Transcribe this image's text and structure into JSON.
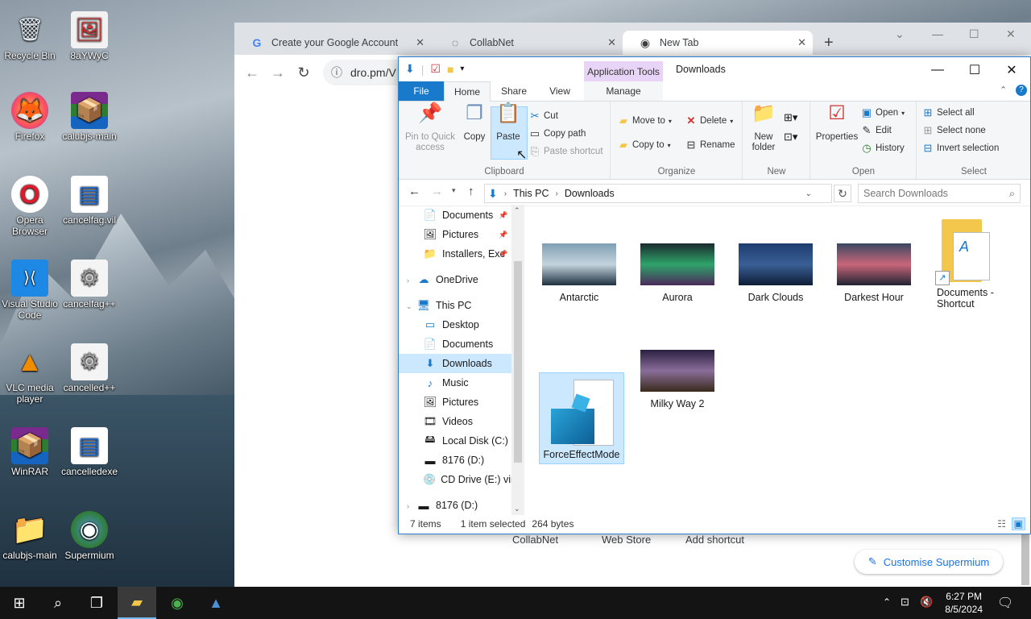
{
  "desktop": {
    "icons": [
      {
        "label": "Recycle Bin",
        "glyph": "🗑"
      },
      {
        "label": "8aYWyC",
        "glyph": "🖼"
      },
      {
        "label": "Firefox",
        "glyph": "🦊"
      },
      {
        "label": "calubjs-main",
        "glyph": "📦"
      },
      {
        "label": "Opera Browser",
        "glyph": "O"
      },
      {
        "label": "cancelfag.vil",
        "glyph": "▤"
      },
      {
        "label": "Visual Studio Code",
        "glyph": "⟩⟨"
      },
      {
        "label": "cancelfag++",
        "glyph": "⚙"
      },
      {
        "label": "VLC media player",
        "glyph": "▲"
      },
      {
        "label": "cancelled++",
        "glyph": "⚙"
      },
      {
        "label": "WinRAR",
        "glyph": "📦"
      },
      {
        "label": "cancelledexe",
        "glyph": "▤"
      },
      {
        "label": "calubjs-main",
        "glyph": "📁"
      },
      {
        "label": "Supermium",
        "glyph": "◉"
      }
    ]
  },
  "browser": {
    "tabs": [
      {
        "label": "Create your Google Account",
        "icon": "G"
      },
      {
        "label": "CollabNet",
        "icon": "◌"
      },
      {
        "label": "New Tab",
        "icon": "◉"
      }
    ],
    "new_tab": "+",
    "url": "dro.pm/V",
    "shortcuts": [
      "CollabNet",
      "Web Store",
      "Add shortcut"
    ],
    "customise_label": "Customise Supermium"
  },
  "explorer": {
    "app_tools": "Application Tools",
    "title": "Downloads",
    "ribbon_tabs": {
      "file": "File",
      "home": "Home",
      "share": "Share",
      "view": "View",
      "manage": "Manage"
    },
    "clipboard": {
      "pin": "Pin to Quick access",
      "copy": "Copy",
      "paste": "Paste",
      "cut": "Cut",
      "copy_path": "Copy path",
      "paste_shortcut": "Paste shortcut",
      "label": "Clipboard"
    },
    "organize": {
      "move_to": "Move to",
      "copy_to": "Copy to",
      "delete": "Delete",
      "rename": "Rename",
      "label": "Organize"
    },
    "new": {
      "new_folder": "New folder",
      "label": "New"
    },
    "open": {
      "properties": "Properties",
      "open": "Open",
      "edit": "Edit",
      "history": "History",
      "label": "Open"
    },
    "select": {
      "select_all": "Select all",
      "select_none": "Select none",
      "invert": "Invert selection",
      "label": "Select"
    },
    "path": {
      "root": "This PC",
      "current": "Downloads"
    },
    "search_placeholder": "Search Downloads",
    "nav": [
      {
        "label": "Documents",
        "icon": "📄",
        "pinned": "📌"
      },
      {
        "label": "Pictures",
        "icon": "🖼",
        "pinned": "📌"
      },
      {
        "label": "Installers, Exe",
        "icon": "📁",
        "pinned": "📌"
      },
      {
        "label": "OneDrive",
        "icon": "☁"
      },
      {
        "label": "This PC",
        "icon": "🖥"
      },
      {
        "label": "Desktop",
        "icon": "▭"
      },
      {
        "label": "Documents",
        "icon": "📄"
      },
      {
        "label": "Downloads",
        "icon": "⬇"
      },
      {
        "label": "Music",
        "icon": "♪"
      },
      {
        "label": "Pictures",
        "icon": "🖼"
      },
      {
        "label": "Videos",
        "icon": "🎞"
      },
      {
        "label": "Local Disk (C:)",
        "icon": "🖴"
      },
      {
        "label": "8176 (D:)",
        "icon": "▬"
      },
      {
        "label": "CD Drive (E:) virt",
        "icon": "💿"
      },
      {
        "label": "8176 (D:)",
        "icon": "▬"
      }
    ],
    "files": [
      {
        "name": "Antarctic",
        "thumb": [
          "#7f9fb3",
          "#c4d3dd",
          "#1f3140"
        ]
      },
      {
        "name": "Aurora",
        "thumb": [
          "#1b2a2e",
          "#2ea36a",
          "#4b2a5a"
        ]
      },
      {
        "name": "Dark Clouds",
        "thumb": [
          "#1d3c6e",
          "#3a5f96",
          "#0e1d36"
        ]
      },
      {
        "name": "Darkest Hour",
        "thumb": [
          "#3a4760",
          "#c9667a",
          "#1f2433"
        ]
      },
      {
        "name": "Documents - Shortcut",
        "thumb": []
      },
      {
        "name": "ForceEffectMode",
        "thumb": []
      },
      {
        "name": "Milky Way 2",
        "thumb": [
          "#2a2040",
          "#8a6e9a",
          "#3a2a1c"
        ]
      }
    ],
    "status": {
      "count": "7 items",
      "selected": "1 item selected",
      "size": "264 bytes"
    }
  },
  "taskbar": {
    "time": "6:27 PM",
    "date": "8/5/2024"
  }
}
